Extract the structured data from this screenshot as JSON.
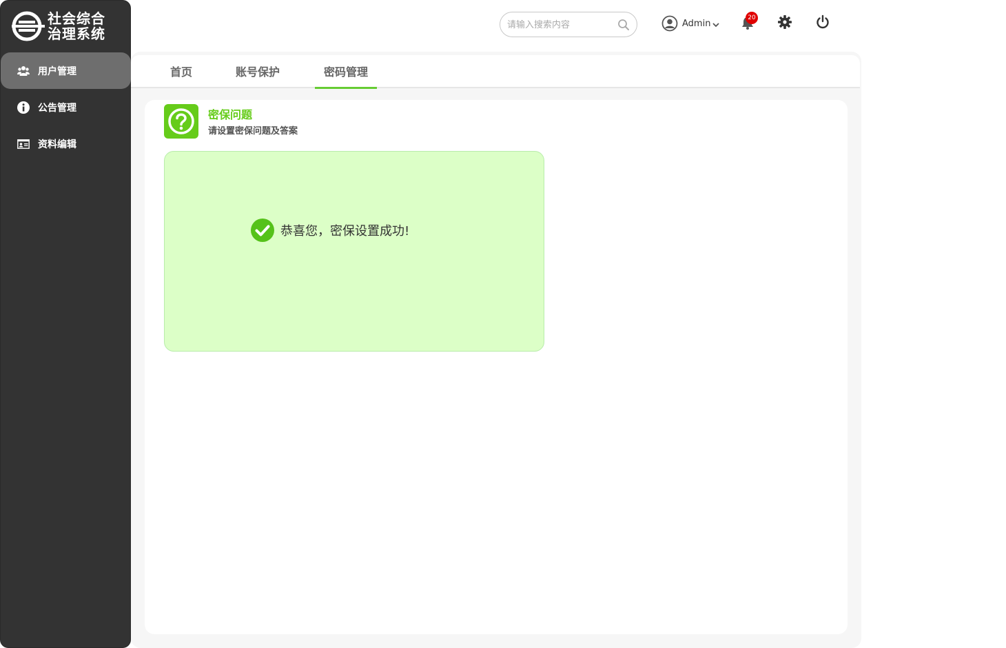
{
  "app": {
    "title_line1": "社会综合",
    "title_line2": "治理系统"
  },
  "sidebar": {
    "items": [
      {
        "label": "用户管理",
        "icon": "users-icon",
        "active": true
      },
      {
        "label": "公告管理",
        "icon": "info-icon",
        "active": false
      },
      {
        "label": "资料编辑",
        "icon": "id-card-icon",
        "active": false
      }
    ]
  },
  "header": {
    "search": {
      "placeholder": "请输入搜索内容",
      "value": ""
    },
    "user": {
      "name": "Admin"
    },
    "notifications": {
      "count": "20"
    }
  },
  "tabs": [
    {
      "label": "首页",
      "active": false
    },
    {
      "label": "账号保护",
      "active": false
    },
    {
      "label": "密码管理",
      "active": true
    }
  ],
  "section": {
    "title": "密保问题",
    "subtitle": "请设置密保问题及答案"
  },
  "result": {
    "message": "恭喜您，密保设置成功!"
  },
  "colors": {
    "sidebar_bg": "#333333",
    "accent_green": "#66cc1a",
    "success_bg": "#dcffc7",
    "badge_red": "#e00000"
  }
}
